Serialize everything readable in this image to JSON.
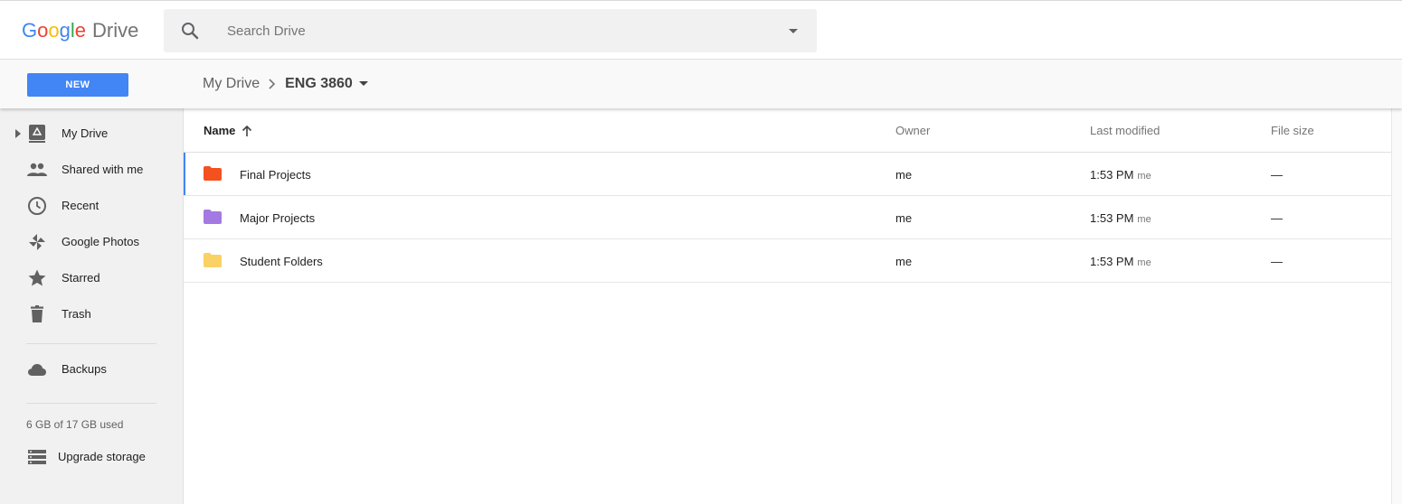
{
  "header": {
    "brand": "Google",
    "product": "Drive",
    "brand_colors": [
      "#4285f4",
      "#ea4335",
      "#fbbc05",
      "#4285f4",
      "#34a853",
      "#ea4335"
    ],
    "search": {
      "placeholder": "Search Drive",
      "value": ""
    }
  },
  "toolbar": {
    "new_label": "NEW",
    "breadcrumb": {
      "root": "My Drive",
      "current": "ENG 3860"
    }
  },
  "sidebar": {
    "items": [
      {
        "label": "My Drive",
        "icon": "my-drive-icon"
      },
      {
        "label": "Shared with me",
        "icon": "people-icon"
      },
      {
        "label": "Recent",
        "icon": "clock-icon"
      },
      {
        "label": "Google Photos",
        "icon": "pinwheel-icon"
      },
      {
        "label": "Starred",
        "icon": "star-icon"
      },
      {
        "label": "Trash",
        "icon": "trash-icon"
      }
    ],
    "backups": {
      "label": "Backups",
      "icon": "cloud-icon"
    },
    "storage": {
      "text": "6 GB of 17 GB used",
      "upgrade_label": "Upgrade storage"
    }
  },
  "file_list": {
    "columns": {
      "name": "Name",
      "owner": "Owner",
      "modified": "Last modified",
      "size": "File size"
    },
    "rows": [
      {
        "name": "Final Projects",
        "owner": "me",
        "modified": "1:53 PM",
        "modified_by": "me",
        "size": "—",
        "color": "#f4511e"
      },
      {
        "name": "Major Projects",
        "owner": "me",
        "modified": "1:53 PM",
        "modified_by": "me",
        "size": "—",
        "color": "#a479e2"
      },
      {
        "name": "Student Folders",
        "owner": "me",
        "modified": "1:53 PM",
        "modified_by": "me",
        "size": "—",
        "color": "#fad165"
      }
    ]
  },
  "colors": {
    "accent": "#4285f4",
    "sidebar_bg": "#f1f1f1"
  }
}
